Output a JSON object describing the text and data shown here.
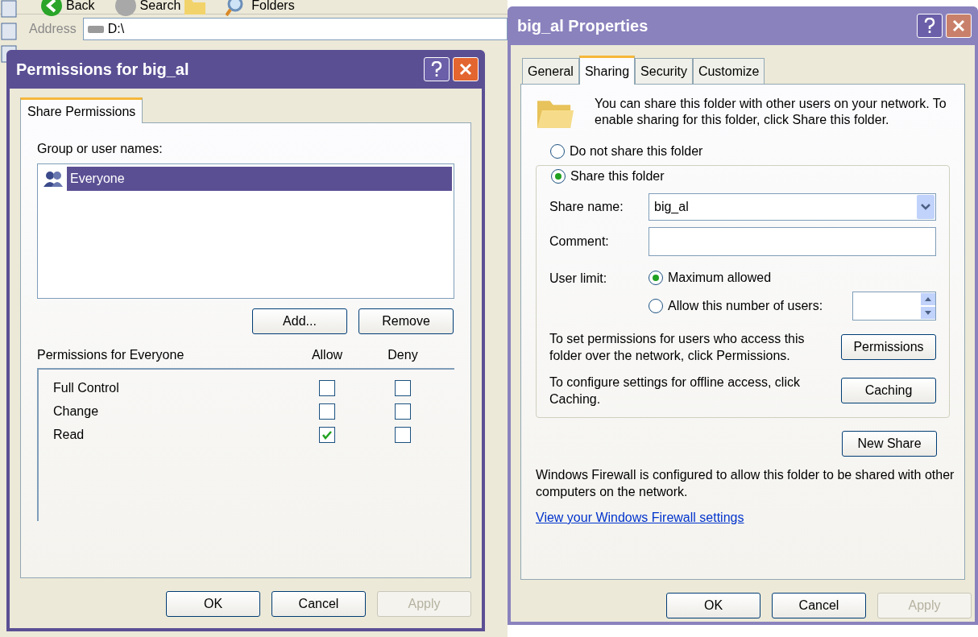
{
  "explorer": {
    "toolbar": [
      {
        "label": "Back"
      },
      {
        "label": "Search"
      },
      {
        "label": "Folders"
      }
    ],
    "address_label": "Address",
    "address": "D:\\"
  },
  "permissions_dialog": {
    "title": "Permissions for big_al",
    "tabs": [
      {
        "label": "Share Permissions",
        "selected": true
      }
    ],
    "group_label": "Group or user names:",
    "users": [
      {
        "name": "Everyone",
        "selected": true
      }
    ],
    "user_buttons": [
      "Add...",
      "Remove"
    ],
    "permissions_label": "Permissions for Everyone",
    "allow_label": "Allow",
    "deny_label": "Deny",
    "permissions": [
      {
        "name": "Full Control",
        "allow": false,
        "deny": false
      },
      {
        "name": "Change",
        "allow": false,
        "deny": false
      },
      {
        "name": "Read",
        "allow": true,
        "deny": false
      }
    ],
    "buttons": [
      {
        "label": "OK",
        "disabled": false
      },
      {
        "label": "Cancel",
        "disabled": false
      },
      {
        "label": "Apply",
        "disabled": true
      }
    ]
  },
  "properties_dialog": {
    "title": "big_al Properties",
    "tabs": [
      {
        "label": "General",
        "selected": false
      },
      {
        "label": "Sharing",
        "selected": true
      },
      {
        "label": "Security",
        "selected": false
      },
      {
        "label": "Customize",
        "selected": false
      }
    ],
    "intro": "You can share this folder with other users on your network.  To enable sharing for this folder, click Share this folder.",
    "share_options": [
      {
        "label": "Do not share this folder",
        "selected": false
      },
      {
        "label": "Share this folder",
        "selected": true
      }
    ],
    "share_name_label": "Share name:",
    "share_name": "big_al",
    "comment_label": "Comment:",
    "user_limit_label": "User limit:",
    "user_limit_options": [
      {
        "label": "Maximum allowed",
        "selected": true
      },
      {
        "label": "Allow this number of users:",
        "selected": false
      }
    ],
    "permissions_text": "To set permissions for users who access this folder over the network, click Permissions.",
    "permissions_button": "Permissions",
    "caching_text": "To configure settings for offline access, click Caching.",
    "caching_button": "Caching",
    "new_share_button": "New Share",
    "firewall_text": "Windows Firewall is configured to allow this folder to be shared with other computers on the network.",
    "firewall_link": "View your Windows Firewall settings",
    "buttons": [
      {
        "label": "OK",
        "disabled": false
      },
      {
        "label": "Cancel",
        "disabled": false
      },
      {
        "label": "Apply",
        "disabled": true
      }
    ]
  }
}
